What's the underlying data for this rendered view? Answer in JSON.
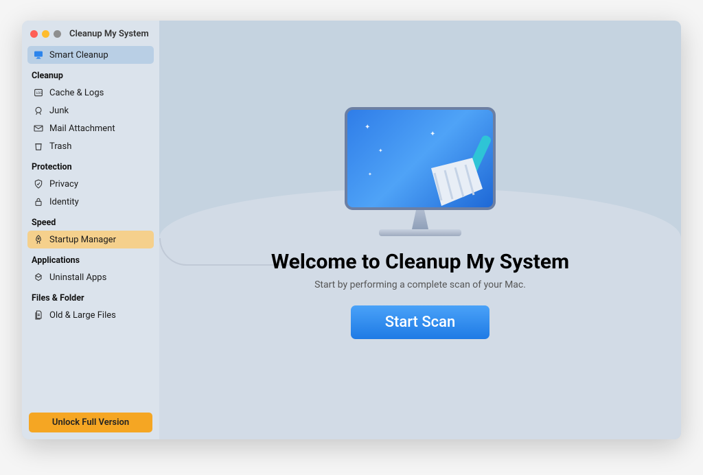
{
  "window": {
    "title": "Cleanup My System"
  },
  "sidebar": {
    "smart_cleanup": "Smart Cleanup",
    "sections": {
      "cleanup": {
        "title": "Cleanup",
        "items": [
          "Cache & Logs",
          "Junk",
          "Mail Attachment",
          "Trash"
        ]
      },
      "protection": {
        "title": "Protection",
        "items": [
          "Privacy",
          "Identity"
        ]
      },
      "speed": {
        "title": "Speed",
        "items": [
          "Startup Manager"
        ]
      },
      "applications": {
        "title": "Applications",
        "items": [
          "Uninstall Apps"
        ]
      },
      "files_folder": {
        "title": "Files & Folder",
        "items": [
          "Old & Large Files"
        ]
      }
    },
    "unlock": "Unlock Full Version"
  },
  "main": {
    "title": "Welcome to Cleanup My System",
    "subtitle": "Start by performing a complete scan of your Mac.",
    "scan_button": "Start Scan"
  },
  "colors": {
    "accent_blue": "#2b84ec",
    "sidebar_bg": "#dbe3ec",
    "highlight": "#f5d08c",
    "selected": "#b9cfe5",
    "unlock": "#f5a623"
  }
}
